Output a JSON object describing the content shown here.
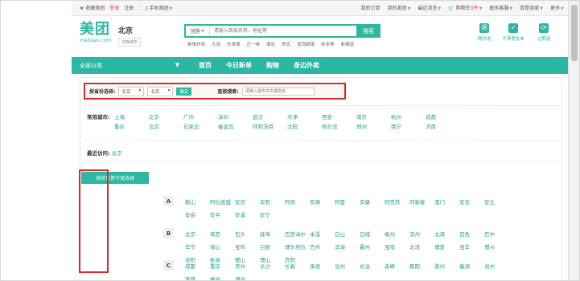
{
  "topbar": {
    "favorite": "收藏美团",
    "login": "登录",
    "register": "注册",
    "mobile": "手机美团",
    "my_orders": "我的订单",
    "my_meituan": "我的美团",
    "recent_view": "最近浏览",
    "cart": "购物车",
    "cart_count": "0件",
    "support": "联系客服",
    "merchant": "我是商家",
    "more": "更多"
  },
  "header": {
    "logo_cn": "美团",
    "logo_en": "meituan.com",
    "city_name": "北京",
    "city_switch": "切换城市",
    "search_category": "团购",
    "search_placeholder": "请输入商品名称、地址等",
    "search_button": "搜索",
    "hot_words": [
      "蚌埠炸鸡",
      "大连",
      "东来顺",
      "正一味",
      "面包",
      "青岛",
      "宝岛眼镜",
      "味多美",
      "新辣道"
    ],
    "services": [
      {
        "label": "随时退",
        "icon": "refund-anytime-icon",
        "glyph": "退"
      },
      {
        "label": "不满意免单",
        "icon": "free-order-icon",
        "glyph": "✓"
      },
      {
        "label": "过期退",
        "icon": "expired-refund-icon",
        "glyph": "⟳"
      }
    ]
  },
  "nav": {
    "all_categories": "全部分类",
    "items": [
      "首页",
      "今日新单",
      "购物",
      "身边外卖"
    ]
  },
  "province": {
    "label": "按省份选择:",
    "province_value": "北京",
    "city_value": "北京",
    "confirm": "确定",
    "direct_label": "直接搜索:",
    "direct_placeholder": "请输入城市中文或拼音"
  },
  "common": {
    "label": "常用城市:",
    "cities": [
      "上海",
      "北京",
      "广州",
      "深圳",
      "武汉",
      "天津",
      "西安",
      "南京",
      "杭州",
      "成都",
      "重庆",
      "北京",
      "石家庄",
      "秦皇岛",
      "呼和浩特",
      "沈阳",
      "哈尔滨",
      "郑州",
      "南宁",
      "济南"
    ]
  },
  "recent": {
    "label": "最近访问:",
    "city": "北京"
  },
  "letters": {
    "header": "按拼音首字母选择",
    "rows": [
      {
        "letter": "A",
        "cities": [
          "鞍山",
          "阿拉善盟",
          "安庆",
          "安阳",
          "阿坝",
          "安顺",
          "阿里",
          "安康",
          "阿克苏",
          "阿勒泰",
          "澳门",
          "安吉",
          "安丘",
          "安岳",
          "安平",
          "安溪",
          "安宁"
        ]
      },
      {
        "letter": "B",
        "cities": [
          "北京",
          "保定",
          "包头",
          "蚌埠",
          "巴彦淖尔",
          "本溪",
          "白山",
          "白城",
          "亳州",
          "滨州",
          "北海",
          "百色",
          "巴中",
          "毕节",
          "保山",
          "宝鸡",
          "白银",
          "博尔塔拉",
          "巴州",
          "滨海",
          "霸州",
          "宝坻",
          "北流",
          "博爱",
          "宝丰",
          "博兴",
          "泌阳",
          "彬县",
          "璧山",
          "博山",
          "宾阳"
        ]
      },
      {
        "letter": "C",
        "cities": [
          "成都",
          "重庆",
          "常州",
          "长沙",
          "长春",
          "承德",
          "沧州",
          "长治",
          "赤峰",
          "朝阳",
          "滁州",
          "巢湖",
          "池州",
          "常德",
          "郴州",
          "潮州"
        ]
      }
    ]
  }
}
